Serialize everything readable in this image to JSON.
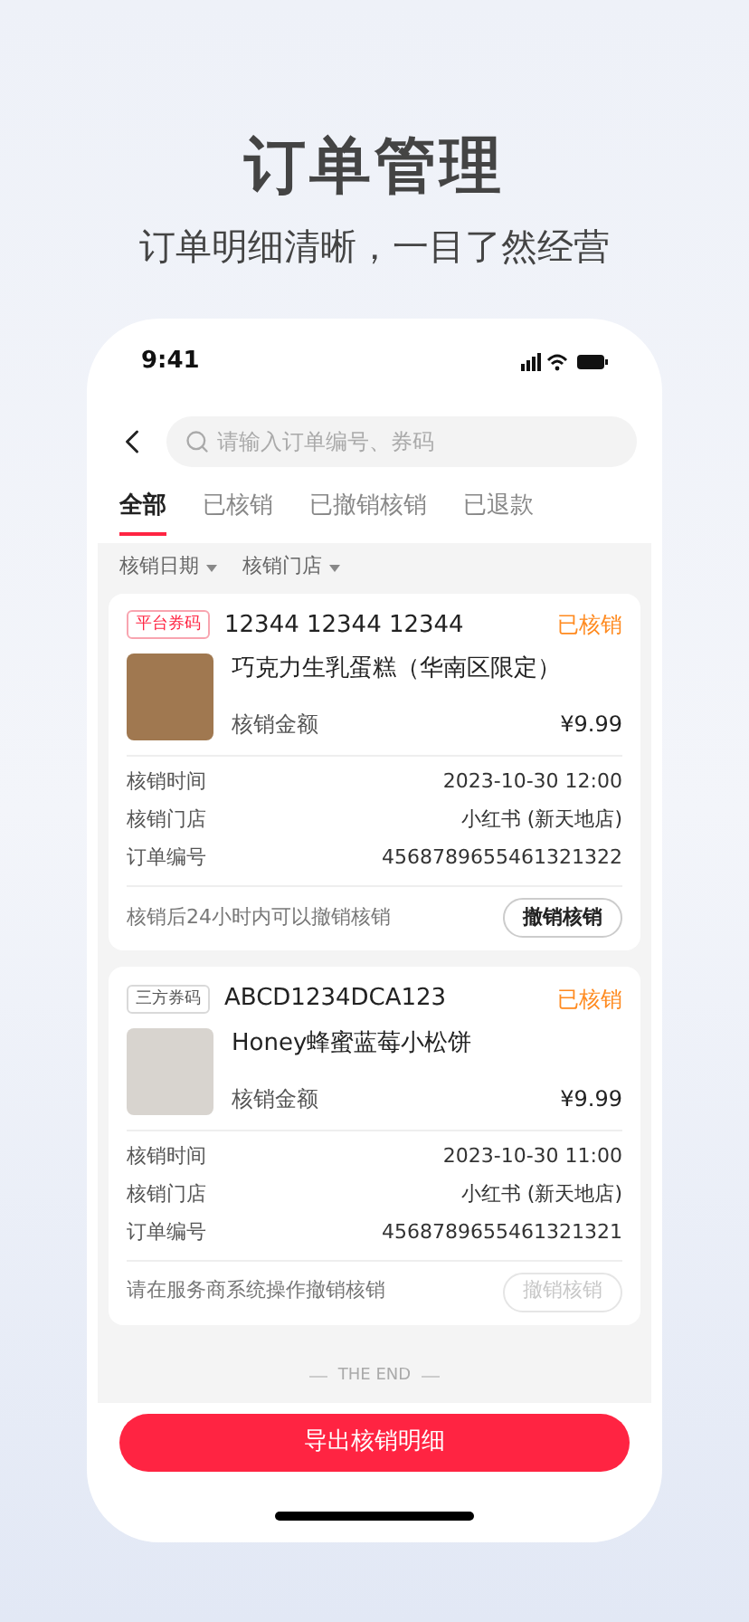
{
  "headline": {
    "title": "订单管理",
    "subtitle": "订单明细清晰，一目了然经营"
  },
  "status_bar": {
    "time": "9:41"
  },
  "search": {
    "placeholder": "请输入订单编号、券码"
  },
  "tabs": [
    {
      "label": "全部",
      "selected": true
    },
    {
      "label": "已核销",
      "selected": false
    },
    {
      "label": "已撤销核销",
      "selected": false
    },
    {
      "label": "已退款",
      "selected": false
    }
  ],
  "filters": [
    "核销日期",
    "核销门店"
  ],
  "orders": [
    {
      "tag": "平台券码",
      "kind": "platform",
      "code": "12344 12344 12344",
      "status": "已核销",
      "product": "巧克力生乳蛋糕（华南区限定）",
      "amount_label": "核销金额",
      "amount": "¥9.99",
      "details": [
        {
          "label": "核销时间",
          "value": "2023-10-30 12:00"
        },
        {
          "label": "核销门店",
          "value": "小红书 (新天地店)"
        },
        {
          "label": "订单编号",
          "value": "4568789655461321322"
        }
      ],
      "note": "核销后24小时内可以撤销核销",
      "action": "撤销核销",
      "action_disabled": false
    },
    {
      "tag": "三方券码",
      "kind": "third_party",
      "code": "ABCD1234DCA123",
      "status": "已核销",
      "product": "Honey蜂蜜蓝莓小松饼",
      "amount_label": "核销金额",
      "amount": "¥9.99",
      "details": [
        {
          "label": "核销时间",
          "value": "2023-10-30 11:00"
        },
        {
          "label": "核销门店",
          "value": "小红书 (新天地店)"
        },
        {
          "label": "订单编号",
          "value": "4568789655461321321"
        }
      ],
      "note": "请在服务商系统操作撤销核销",
      "action": "撤销核销",
      "action_disabled": true
    }
  ],
  "end_marker": "THE END",
  "export_button": "导出核销明细"
}
